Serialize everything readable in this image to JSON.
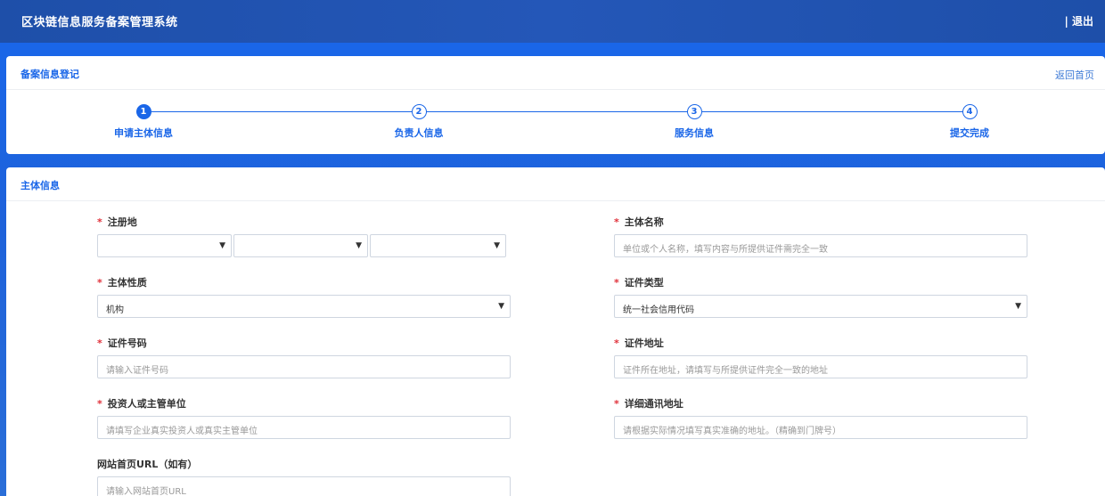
{
  "header": {
    "title": "区块链信息服务备案管理系统",
    "logout_label": "| 退出"
  },
  "steps_card": {
    "title": "备案信息登记",
    "back_label": "返回首页",
    "steps": [
      {
        "num": "1",
        "label": "申请主体信息",
        "active": true
      },
      {
        "num": "2",
        "label": "负责人信息",
        "active": false
      },
      {
        "num": "3",
        "label": "服务信息",
        "active": false
      },
      {
        "num": "4",
        "label": "提交完成",
        "active": false
      }
    ]
  },
  "form": {
    "title": "主体信息",
    "required_mark": "*",
    "fields": {
      "register_place": {
        "label": "注册地",
        "values": [
          "",
          "",
          ""
        ]
      },
      "entity_name": {
        "label": "主体名称",
        "placeholder": "单位或个人名称，填写内容与所提供证件需完全一致"
      },
      "entity_nature": {
        "label": "主体性质",
        "value": "机构"
      },
      "cert_type": {
        "label": "证件类型",
        "value": "统一社会信用代码"
      },
      "cert_number": {
        "label": "证件号码",
        "placeholder": "请输入证件号码"
      },
      "cert_address": {
        "label": "证件地址",
        "placeholder": "证件所在地址，请填写与所提供证件完全一致的地址"
      },
      "investor": {
        "label": "投资人或主管单位",
        "placeholder": "请填写企业真实投资人或真实主管单位"
      },
      "contact_address": {
        "label": "详细通讯地址",
        "placeholder": "请根据实际情况填写真实准确的地址。（精确到门牌号）"
      },
      "website": {
        "label": "网站首页URL（如有）",
        "placeholder": "请输入网站首页URL"
      }
    },
    "dropdown_arrow": "▼"
  }
}
